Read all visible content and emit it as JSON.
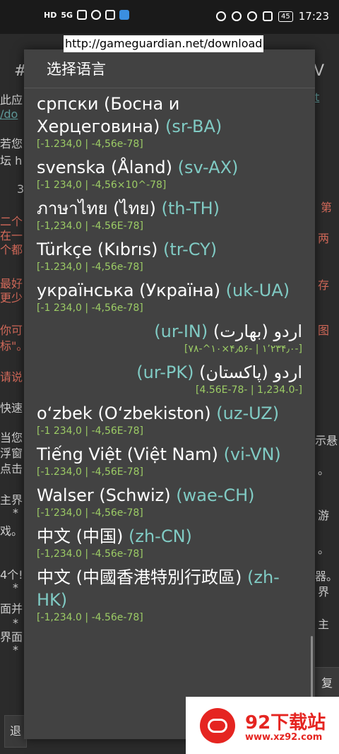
{
  "status_bar": {
    "left_labels": [
      "HD",
      "5G"
    ],
    "battery": "45",
    "time": "17:23"
  },
  "url_banner": "http://gameguardian.net/download",
  "background": {
    "fragments": [
      "#",
      "此应",
      "/do",
      "若您",
      "坛 h",
      "3",
      "二个",
      "在一",
      "个都",
      "最好",
      "更少",
      "你可",
      "标\"。",
      "请说",
      "快速",
      "当您",
      "浮窗",
      "点击",
      "主界",
      "*",
      "戏。",
      "4个!",
      "*",
      "面并",
      "*",
      "界面",
      "*",
      "退",
      "V",
      "t",
      "第",
      "两",
      "存",
      "图",
      "示悬",
      "。",
      "游",
      "。",
      "器。",
      "界",
      "主",
      "复"
    ]
  },
  "dialog": {
    "title": "选择语言",
    "languages": [
      {
        "name": "српски (Босна и Херцеговина)",
        "code": "(sr-BA)",
        "format": "[-1.234,0 | -4,56e-78]",
        "rtl": false
      },
      {
        "name": "svenska (Åland)",
        "code": "(sv-AX)",
        "format": "[-1 234,0 | -4,56×10^-78]",
        "rtl": false
      },
      {
        "name": "ภาษาไทย (ไทย)",
        "code": "(th-TH)",
        "format": "[-1,234.0 | -4.56E-78]",
        "rtl": false
      },
      {
        "name": "Türkçe (Kıbrıs)",
        "code": "(tr-CY)",
        "format": "[-1.234,0 | -4,56e-78]",
        "rtl": false
      },
      {
        "name": "українська (Україна)",
        "code": "(uk-UA)",
        "format": "[-1 234,0 | -4,56e-78]",
        "rtl": false
      },
      {
        "name": "اردو (بھارت)",
        "code": "(ur-IN)",
        "format": "[-۱٬۲۳۴٫۰ | -۴٫۵۶×۱۰^-۷۸]",
        "rtl": true
      },
      {
        "name": "اردو (پاکستان)",
        "code": "(ur-PK)",
        "format": "[-1,234.0 | -4.56E-78]",
        "rtl": true
      },
      {
        "name": "o‘zbek (Oʻzbekiston)",
        "code": "(uz-UZ)",
        "format": "[-1 234,0 | -4,56E-78]",
        "rtl": false
      },
      {
        "name": "Tiếng Việt (Việt Nam)",
        "code": "(vi-VN)",
        "format": "[-1.234,0 | -4,56E-78]",
        "rtl": false
      },
      {
        "name": "Walser (Schwiz)",
        "code": "(wae-CH)",
        "format": "[-1’234,0 | -4,56e-78]",
        "rtl": false
      },
      {
        "name": "中文 (中国)",
        "code": "(zh-CN)",
        "format": "[-1,234.0 | -4.56e-78]",
        "rtl": false
      },
      {
        "name": "中文 (中國香港特別行政區)",
        "code": "(zh-HK)",
        "format": "[-1,234.0 | -4.56e-78]",
        "rtl": false
      }
    ]
  },
  "watermark": {
    "title": "92下载站",
    "url": "www.xz92.com"
  },
  "colors": {
    "dialog_bg": "#424242",
    "code": "#80cbc4",
    "format": "#9ccc65",
    "watermark_red": "#e52521"
  }
}
